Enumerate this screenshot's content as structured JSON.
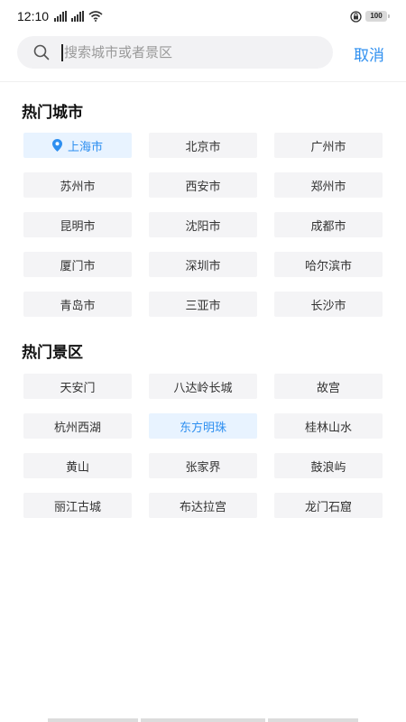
{
  "status_bar": {
    "time": "12:10",
    "battery": "100"
  },
  "search": {
    "placeholder": "搜索城市或者景区",
    "value": "",
    "cancel_label": "取消"
  },
  "hot_cities": {
    "title": "热门城市",
    "items": [
      "上海市",
      "北京市",
      "广州市",
      "苏州市",
      "西安市",
      "郑州市",
      "昆明市",
      "沈阳市",
      "成都市",
      "厦门市",
      "深圳市",
      "哈尔滨市",
      "青岛市",
      "三亚市",
      "长沙市"
    ]
  },
  "hot_scenic": {
    "title": "热门景区",
    "items": [
      "天安门",
      "八达岭长城",
      "故宫",
      "杭州西湖",
      "东方明珠",
      "桂林山水",
      "黄山",
      "张家界",
      "鼓浪屿",
      "丽江古城",
      "布达拉宫",
      "龙门石窟"
    ]
  },
  "colors": {
    "accent": "#2e8ff0",
    "chip_bg": "#f4f4f6",
    "chip_active_bg": "#e8f3ff"
  }
}
